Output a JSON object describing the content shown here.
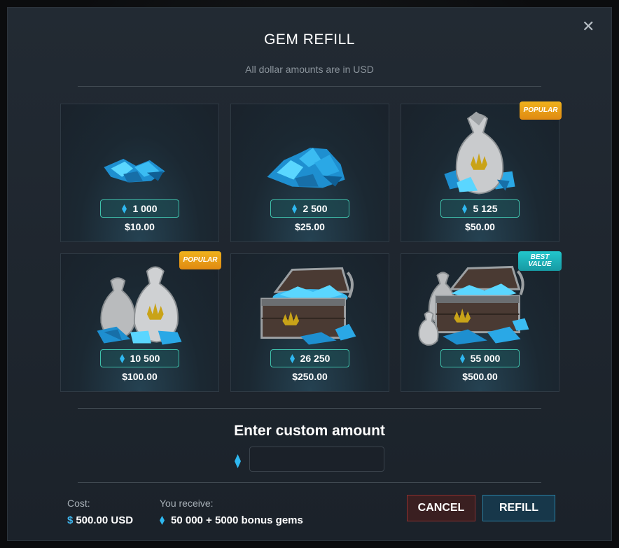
{
  "modal": {
    "title": "GEM REFILL",
    "subtitle": "All dollar amounts are in USD",
    "close_glyph": "✕"
  },
  "packages": [
    {
      "gems": "1 000",
      "price": "$10.00",
      "badge": "",
      "image": "small-gem-pile"
    },
    {
      "gems": "2 500",
      "price": "$25.00",
      "badge": "",
      "image": "medium-gem-pile"
    },
    {
      "gems": "5 125",
      "price": "$50.00",
      "badge": "POPULAR",
      "image": "gem-sack"
    },
    {
      "gems": "10 500",
      "price": "$100.00",
      "badge": "POPULAR",
      "image": "two-gem-sacks"
    },
    {
      "gems": "26 250",
      "price": "$250.00",
      "badge": "",
      "image": "gem-chest"
    },
    {
      "gems": "55 000",
      "price": "$500.00",
      "badge": "BEST VALUE",
      "image": "gem-chest-with-sacks"
    }
  ],
  "custom": {
    "title": "Enter custom amount",
    "input_value": "",
    "input_placeholder": ""
  },
  "summary": {
    "cost_label": "Cost:",
    "cost_currency": "$",
    "cost_value": "500.00 USD",
    "receive_label": "You receive:",
    "receive_value": "50 000 + 5000 bonus gems"
  },
  "buttons": {
    "cancel": "CANCEL",
    "refill": "REFILL"
  },
  "colors": {
    "gem_blue": "#2fb8f0",
    "pill_border": "#3fc1ac",
    "popular_badge": "#f0a21a",
    "best_value_badge": "#1fb6be",
    "cancel_border": "#8b2f2f",
    "refill_border": "#2a7fa2"
  }
}
